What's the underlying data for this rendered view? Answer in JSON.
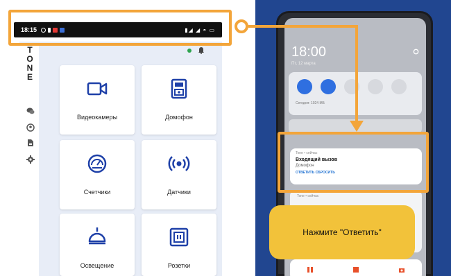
{
  "status_bar": {
    "time": "18:15",
    "right_icons": "signal wifi battery"
  },
  "brand": {
    "letters": [
      "T",
      "O",
      "N",
      "E"
    ]
  },
  "sidebar": {
    "icons": [
      "chat-icon",
      "profile-icon",
      "document-icon",
      "settings-icon"
    ]
  },
  "tiles": [
    {
      "label": "Видеокамеры",
      "icon": "video-camera-icon"
    },
    {
      "label": "Домофон",
      "icon": "intercom-icon"
    },
    {
      "label": "Счетчики",
      "icon": "meter-icon"
    },
    {
      "label": "Датчики",
      "icon": "sensor-icon"
    },
    {
      "label": "Освещение",
      "icon": "lamp-icon"
    },
    {
      "label": "Розетки",
      "icon": "socket-icon"
    }
  ],
  "notification_shade": {
    "clock": "18:00",
    "date": "Пт, 12 марта",
    "qs_info": "Сегодня: 1024 МБ",
    "notification": {
      "app": "Tone • сейчас",
      "title": "Входящий вызов",
      "subtitle": "Домофон",
      "actions": "ОТВЕТИТЬ   СБРОСИТЬ"
    },
    "notif2_text": "Tone • сейчас"
  },
  "hint": {
    "text": "Нажмите \"Ответить\""
  },
  "colors": {
    "highlight": "#f3a53a",
    "hint_bg": "#f2c23a",
    "primary_blue": "#1e40a8",
    "panel_blue": "#214690"
  }
}
